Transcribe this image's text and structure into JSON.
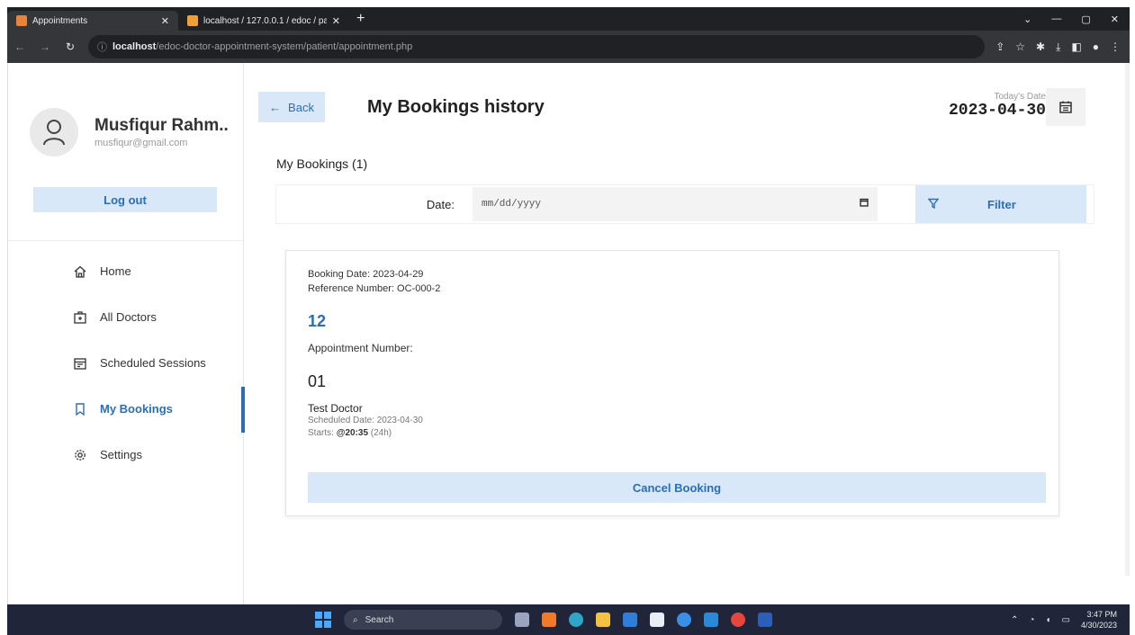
{
  "browser": {
    "tabs": [
      {
        "title": "Appointments",
        "active": true,
        "color": "#e8833a"
      },
      {
        "title": "localhost / 127.0.0.1 / edoc / pa",
        "active": false,
        "color": "#f0a030"
      }
    ],
    "url_host": "localhost",
    "url_path": "/edoc-doctor-appointment-system/patient/appointment.php"
  },
  "sidebar": {
    "user_name": "Musfiqur Rahm..",
    "user_email": "musfiqur@gmail.com",
    "logout_label": "Log out",
    "items": [
      {
        "label": "Home",
        "icon": "home-icon",
        "active": false
      },
      {
        "label": "All Doctors",
        "icon": "doctor-icon",
        "active": false
      },
      {
        "label": "Scheduled Sessions",
        "icon": "schedule-icon",
        "active": false
      },
      {
        "label": "My Bookings",
        "icon": "bookmark-icon",
        "active": true
      },
      {
        "label": "Settings",
        "icon": "gear-icon",
        "active": false
      }
    ]
  },
  "header": {
    "back_label": "Back",
    "title": "My Bookings history",
    "today_label": "Today's Date",
    "today_value": "2023-04-30"
  },
  "main": {
    "subtitle": "My Bookings (1)",
    "filter": {
      "date_label": "Date:",
      "date_placeholder": "mm/dd/yyyy",
      "filter_label": "Filter"
    },
    "booking": {
      "booking_date": "Booking Date: 2023-04-29",
      "reference": "Reference Number: OC-000-2",
      "appointment_value": "12",
      "appointment_label": "Appointment Number:",
      "session_number": "01",
      "doctor": "Test Doctor",
      "scheduled_date": "Scheduled Date: 2023-04-30",
      "starts_prefix": "Starts: ",
      "starts_time": "@20:35",
      "starts_suffix": " (24h)",
      "cancel_label": "Cancel Booking"
    }
  },
  "taskbar": {
    "search_label": "Search",
    "time": "3:47 PM",
    "date": "4/30/2023"
  },
  "colors": {
    "accent": "#2d6db5",
    "accent_light": "#d8e8f8"
  }
}
